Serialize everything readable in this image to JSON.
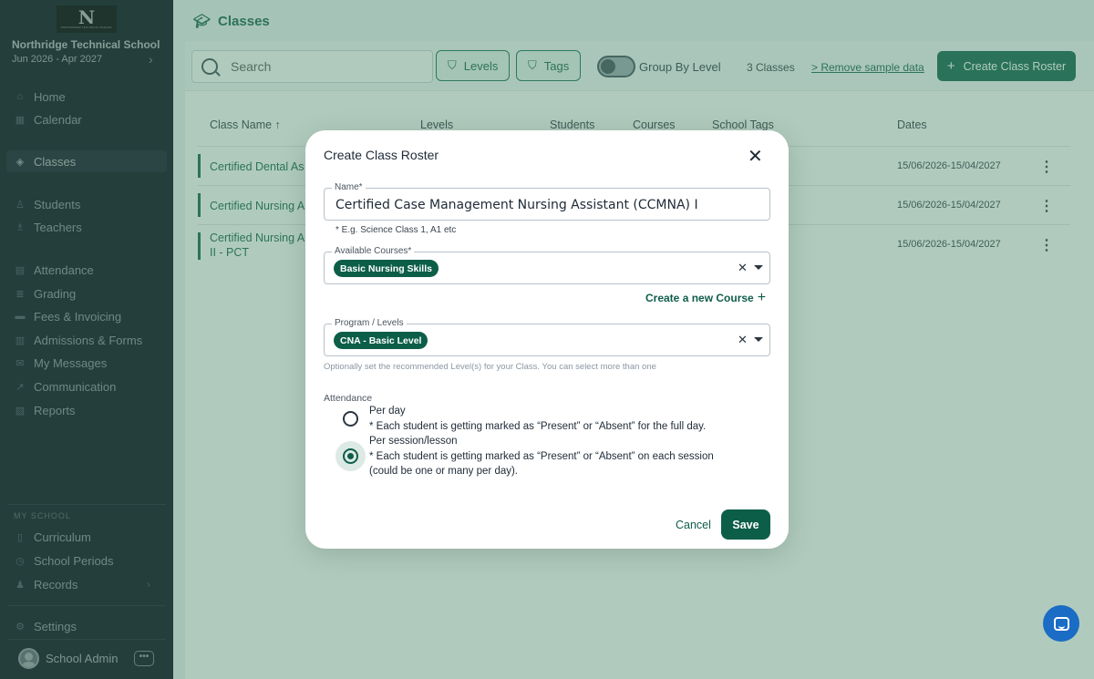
{
  "sidebar": {
    "logo_letters": "N",
    "logo_tagline": "NORTHRIDGE TECHNICAL SCHOOL",
    "school_name": "Northridge Technical School",
    "period": "Jun 2026 - Apr 2027",
    "items": [
      {
        "label": "Home",
        "icon": "home-icon"
      },
      {
        "label": "Calendar",
        "icon": "calendar-icon"
      },
      {
        "label": "Classes",
        "icon": "graduation-cap-icon",
        "active": true
      },
      {
        "label": "Students",
        "icon": "user-icon"
      },
      {
        "label": "Teachers",
        "icon": "teacher-icon"
      },
      {
        "label": "Attendance",
        "icon": "attendance-icon"
      },
      {
        "label": "Grading",
        "icon": "grading-icon"
      },
      {
        "label": "Fees & Invoicing",
        "icon": "fees-icon"
      },
      {
        "label": "Admissions & Forms",
        "icon": "admissions-icon"
      },
      {
        "label": "My Messages",
        "icon": "mail-icon"
      },
      {
        "label": "Communication",
        "icon": "send-icon"
      },
      {
        "label": "Reports",
        "icon": "reports-icon"
      }
    ],
    "section_label": "MY SCHOOL",
    "school_items": [
      {
        "label": "Curriculum",
        "icon": "book-icon"
      },
      {
        "label": "School Periods",
        "icon": "period-icon"
      },
      {
        "label": "Records",
        "icon": "records-icon"
      }
    ],
    "settings_label": "Settings",
    "user_name": "School Admin",
    "user_more": "•••"
  },
  "header": {
    "title": "Classes"
  },
  "toolbar": {
    "search_placeholder": "Search",
    "levels_label": "Levels",
    "tags_label": "Tags",
    "group_label": "Group By Level",
    "count_text": "3 Classes",
    "remove_link": "> Remove sample data",
    "create_button": "Create Class Roster"
  },
  "table": {
    "headers": [
      "Class Name ↑",
      "Levels",
      "Students",
      "Courses",
      "School Tags",
      "Dates"
    ],
    "rows": [
      {
        "name": "Certified Dental As",
        "dates": "15/06/2026-15/04/2027"
      },
      {
        "name": "Certified Nursing A",
        "dates": "15/06/2026-15/04/2027"
      },
      {
        "name": "Certified Nursing A",
        "name2": "II - PCT",
        "dates": "15/06/2026-15/04/2027"
      }
    ]
  },
  "modal": {
    "title": "Create Class Roster",
    "close": "✕",
    "name_legend": "Name*",
    "name_value": "Certified Case Management Nursing Assistant (CCMNA) I",
    "name_hint": "* E.g. Science Class 1, A1 etc",
    "courses_legend": "Available Courses*",
    "courses_tag": "Basic Nursing Skills",
    "create_course": "Create a new Course",
    "levels_legend": "Program / Levels",
    "levels_tag": "CNA - Basic Level",
    "levels_hint": "Optionally set the recommended Level(s) for your Class. You can select more than one",
    "attendance_label": "Attendance",
    "per_day_title": "Per day",
    "per_day_desc": "* Each student is getting marked as “Present” or “Absent” for the full day.",
    "per_session_title": "Per session/lesson",
    "per_session_desc": "* Each student is getting marked as “Present” or “Absent” on each session",
    "per_session_desc2": "(could be one or many per day).",
    "selected_attendance": "Per session/lesson",
    "cancel": "Cancel",
    "save": "Save"
  },
  "colors": {
    "accent": "#0c5e48",
    "sidebar": "#101a24",
    "chat": "#1a6cc4"
  }
}
